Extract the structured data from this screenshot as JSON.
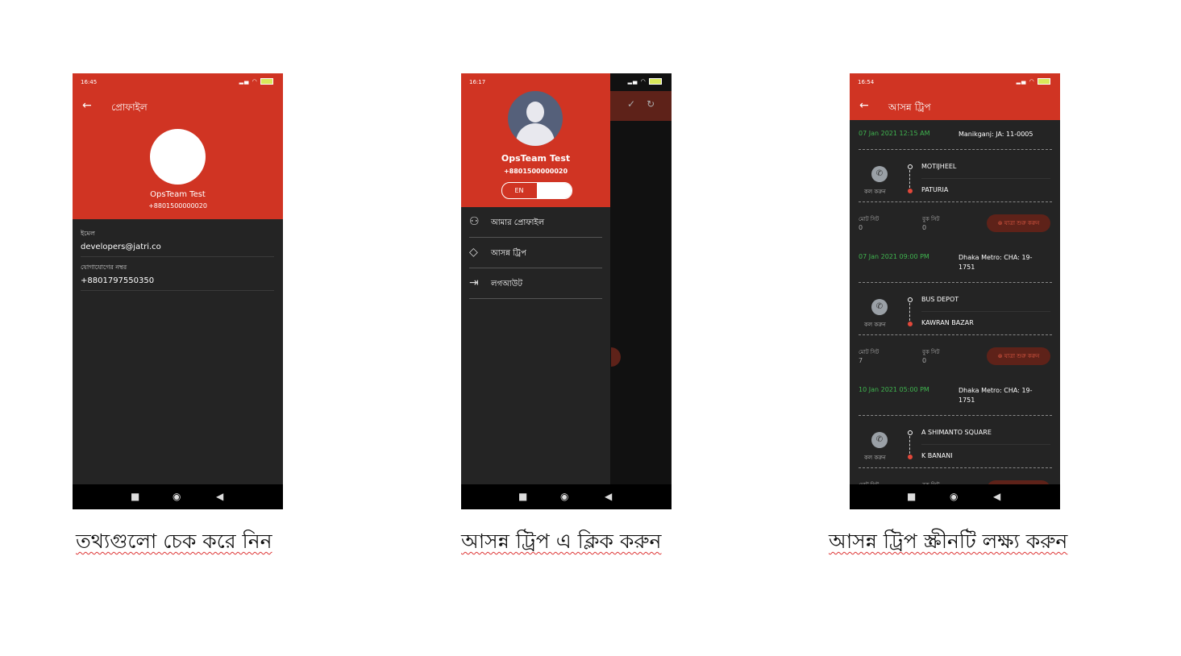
{
  "screens": [
    {
      "status_time": "16:45",
      "title": "প্রোফাইল",
      "name": "OpsTeam Test",
      "phone": "+8801500000020",
      "fields": [
        {
          "label": "ইমেল",
          "value": "developers@jatri.co"
        },
        {
          "label": "যোগাযোগের নম্বর",
          "value": "+8801797550350"
        }
      ],
      "caption": "তথ্যগুলো চেক করে নিন"
    },
    {
      "status_time": "16:17",
      "name": "OpsTeam Test",
      "phone": "+8801500000020",
      "lang_label": "EN",
      "menu": [
        {
          "label": "আমার প্রোফাইল",
          "icon": "person-icon"
        },
        {
          "label": "আসন্ন ট্রিপ",
          "icon": "ticket-icon"
        },
        {
          "label": "লগআউট",
          "icon": "logout-icon"
        }
      ],
      "caption": "আসন্ন ট্রিপ এ ক্লিক করুন"
    },
    {
      "status_time": "16:54",
      "title": "আসন্ন ট্রিপ",
      "call_label": "কল করুন",
      "total_seat_label": "মোট সিট",
      "booked_seat_label": "বুক সিট",
      "start_trip_label": "যাত্রা শুরু করুন",
      "trips": [
        {
          "datetime": "07 Jan 2021 12:15 AM",
          "bus": "Manikganj: JA: 11-0005",
          "from": "MOTIJHEEL",
          "to": "PATURIA",
          "total_seats": "0",
          "booked_seats": "0"
        },
        {
          "datetime": "07 Jan 2021 09:00 PM",
          "bus": "Dhaka Metro: CHA: 19-1751",
          "from": "BUS DEPOT",
          "to": "KAWRAN BAZAR",
          "total_seats": "7",
          "booked_seats": "0"
        },
        {
          "datetime": "10 Jan 2021 05:00 PM",
          "bus": "Dhaka Metro: CHA: 19-1751",
          "from": "A SHIMANTO SQUARE",
          "to": "K BANANI",
          "total_seats": "",
          "booked_seats": ""
        }
      ],
      "caption": "আসন্ন ট্রিপ স্ক্রীনটি লক্ষ্য করুন"
    }
  ],
  "colors": {
    "brand_red": "#d03423",
    "dark_bg": "#242424",
    "green": "#3fb54f"
  }
}
